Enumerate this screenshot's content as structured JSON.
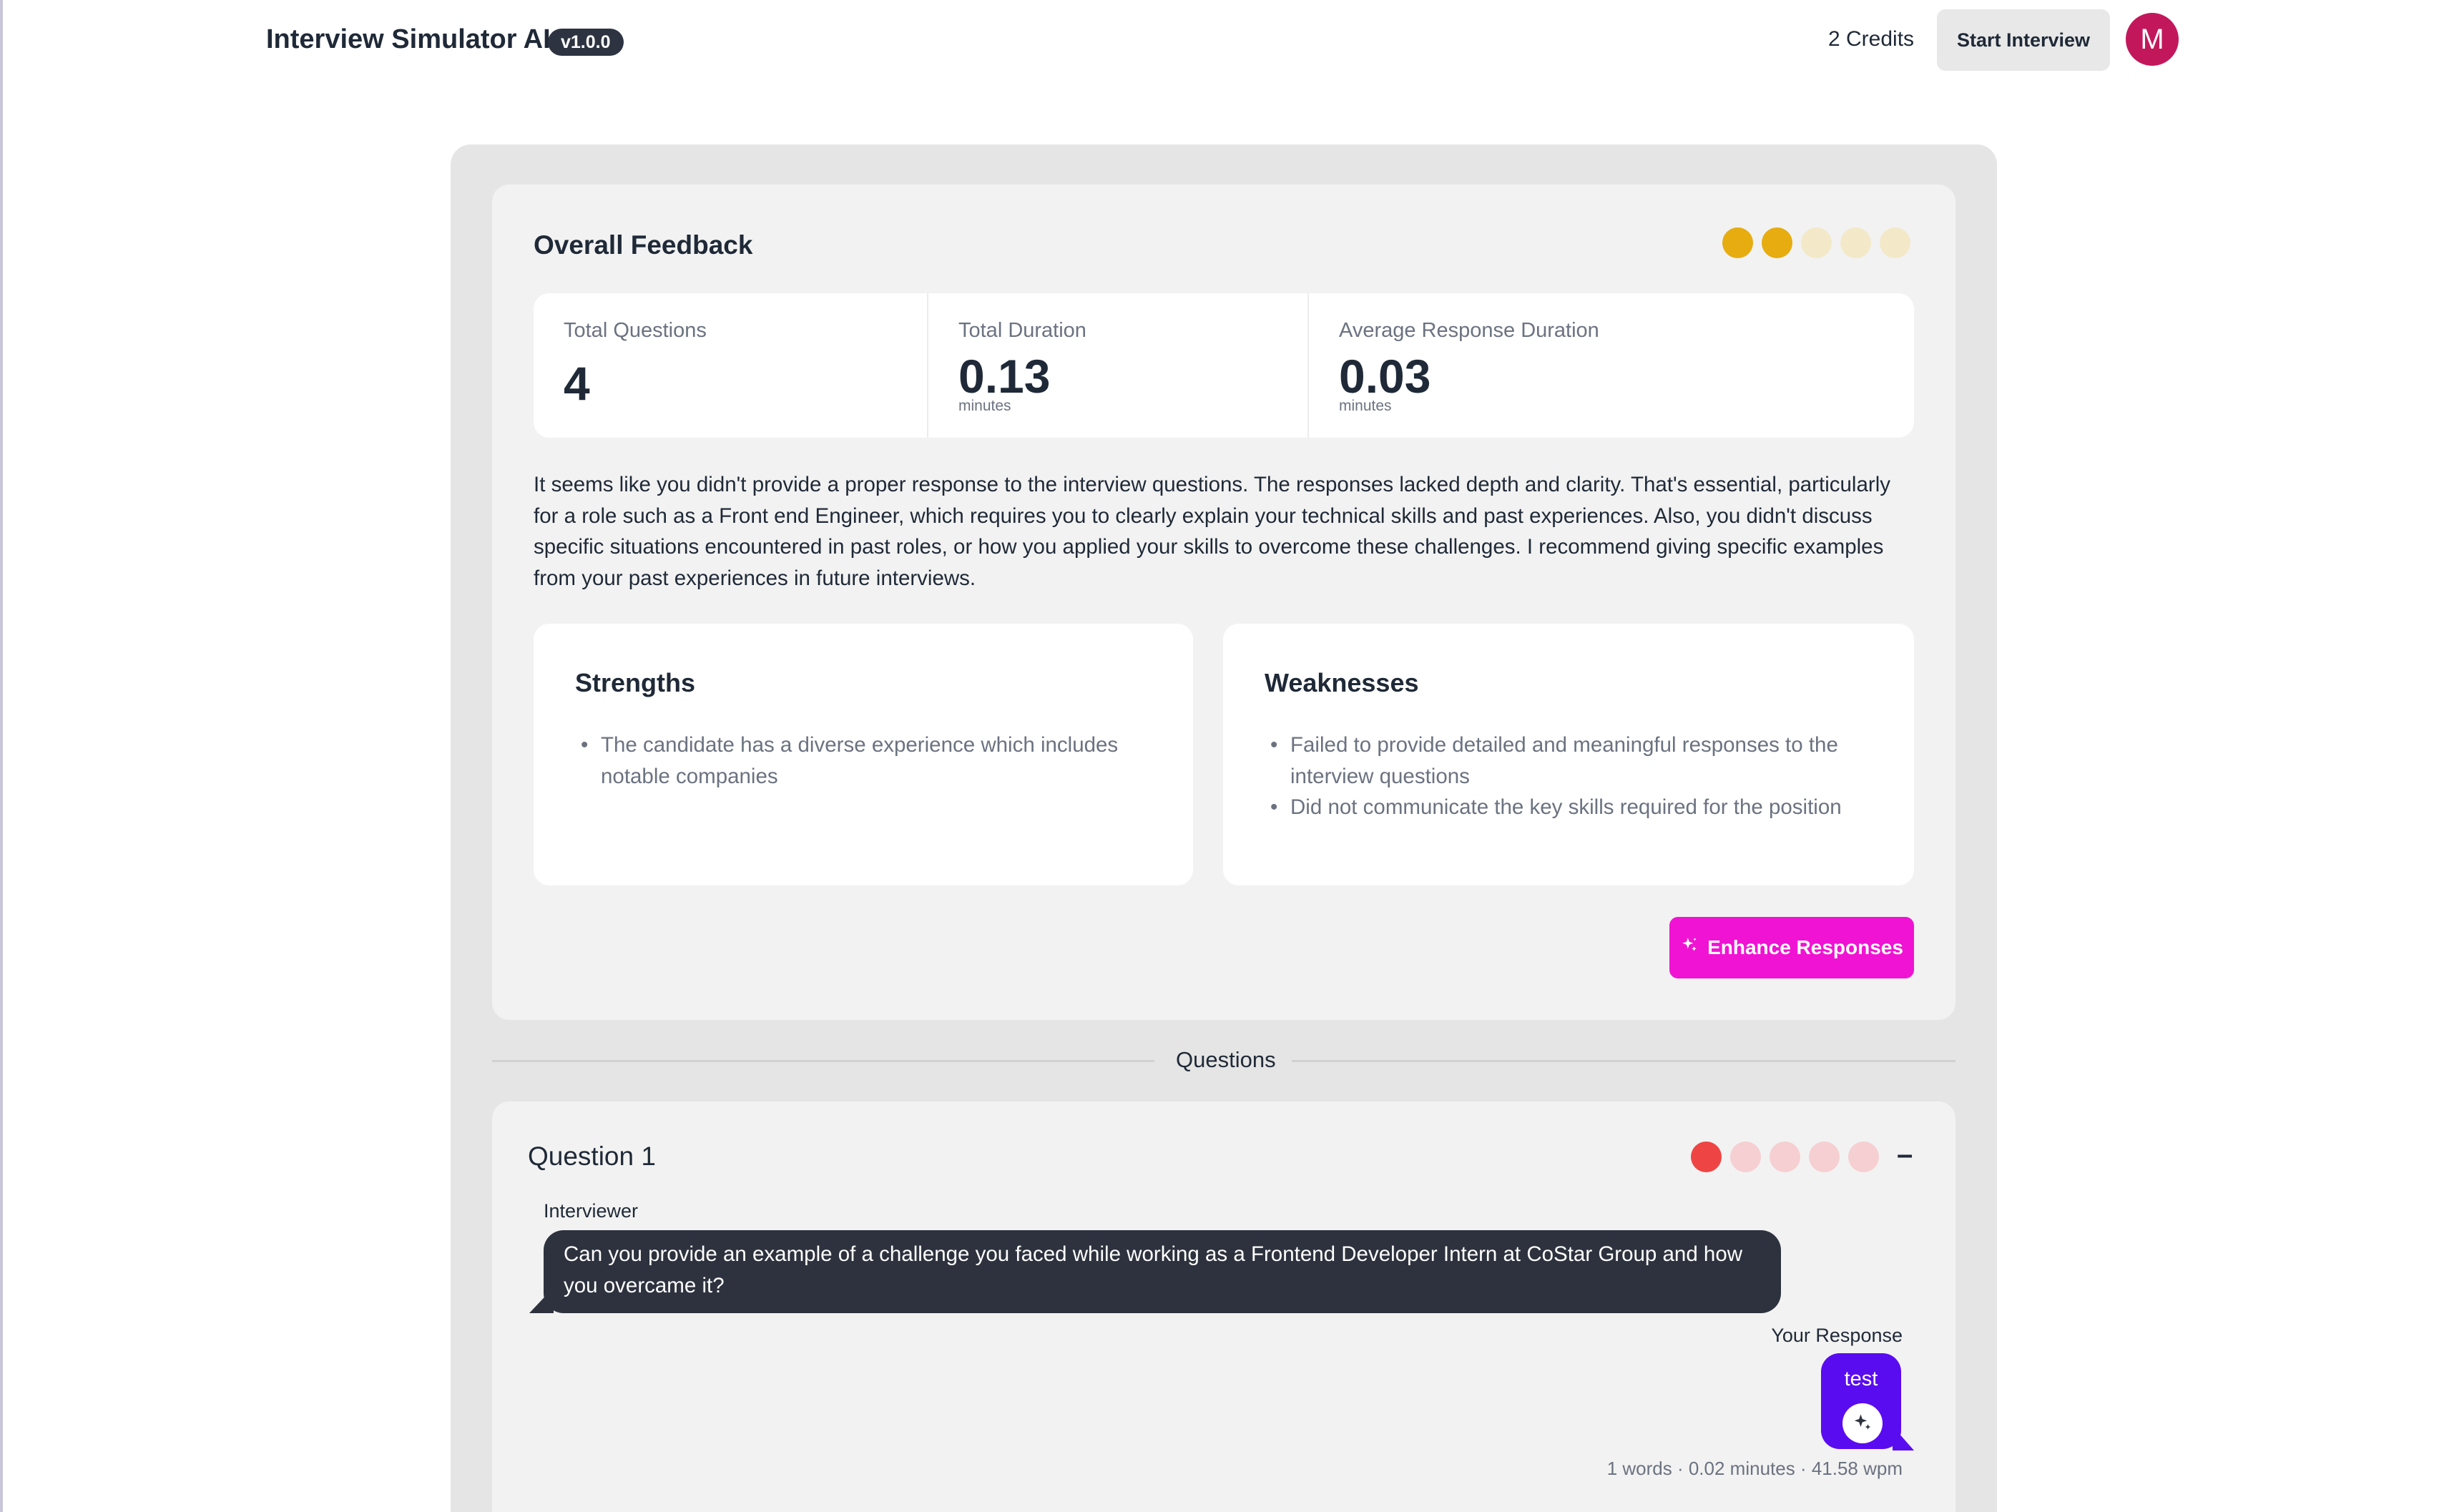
{
  "app": {
    "title": "Interview Simulator AI",
    "version": "v1.0.0"
  },
  "header": {
    "credits": "2 Credits",
    "start_label": "Start Interview",
    "avatar_initial": "M"
  },
  "overall": {
    "title": "Overall Feedback",
    "rating": {
      "filled": 2,
      "total": 5,
      "color": "#e6ac10",
      "empty_color": "#f3e8c8"
    },
    "stats": [
      {
        "label": "Total Questions",
        "value": "4",
        "unit": ""
      },
      {
        "label": "Total Duration",
        "value": "0.13",
        "unit": "minutes"
      },
      {
        "label": "Average Response Duration",
        "value": "0.03",
        "unit": "minutes"
      }
    ],
    "summary": "It seems like you didn't provide a proper response to the interview questions. The responses lacked depth and clarity. That's essential, particularly for a role such as a Front end Engineer, which requires you to clearly explain your technical skills and past experiences. Also, you didn't discuss specific situations encountered in past roles, or how you applied your skills to overcome these challenges. I recommend giving specific examples from your past experiences in future interviews.",
    "strengths": {
      "title": "Strengths",
      "items": [
        "The candidate has a diverse experience which includes notable companies"
      ]
    },
    "weaknesses": {
      "title": "Weaknesses",
      "items": [
        "Failed to provide detailed and meaningful responses to the interview questions",
        "Did not communicate the key skills required for the position"
      ]
    },
    "enhance_label": "Enhance Responses"
  },
  "questions_divider": "Questions",
  "question": {
    "title": "Question 1",
    "collapse_symbol": "–",
    "rating": {
      "filled": 1,
      "total": 5,
      "color": "#ef4444",
      "empty_color": "#f6cfd2"
    },
    "interviewer_label": "Interviewer",
    "question_text": "Can you provide an example of a challenge you faced while working as a Frontend Developer Intern at CoStar Group and how you overcame it?",
    "response_label": "Your Response",
    "response_text": "test",
    "response_stats": "1 words · 0.02 minutes · 41.58 wpm"
  },
  "icons": [
    "sparkle-icon",
    "sparkle-icon"
  ]
}
